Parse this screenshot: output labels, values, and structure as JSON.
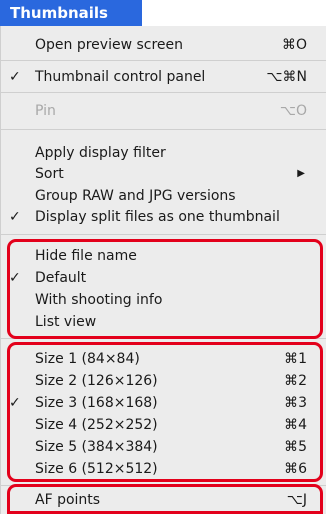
{
  "menu": {
    "title": "Thumbnails"
  },
  "items": [
    {
      "label": "Open preview screen",
      "shortcut": "⌘O"
    },
    {
      "check": "✓",
      "label": "Thumbnail control panel",
      "shortcut": "⌥⌘N"
    },
    {
      "label": "Pin",
      "shortcut": "⌥O"
    },
    {
      "label": "Apply display filter"
    },
    {
      "label": "Sort",
      "submenu_arrow": "▶"
    },
    {
      "label": "Group RAW and JPG versions"
    },
    {
      "check": "✓",
      "label": "Display split files as one thumbnail"
    },
    {
      "label": "Hide file name"
    },
    {
      "check": "✓",
      "label": "Default"
    },
    {
      "label": "With shooting info"
    },
    {
      "label": "List view"
    },
    {
      "label": "Size 1 (84×84)",
      "shortcut": "⌘1"
    },
    {
      "label": "Size 2 (126×126)",
      "shortcut": "⌘2"
    },
    {
      "check": "✓",
      "label": "Size 3 (168×168)",
      "shortcut": "⌘3"
    },
    {
      "label": "Size 4 (252×252)",
      "shortcut": "⌘4"
    },
    {
      "label": "Size 5 (384×384)",
      "shortcut": "⌘5"
    },
    {
      "label": "Size 6 (512×512)",
      "shortcut": "⌘6"
    },
    {
      "label": "AF points",
      "shortcut": "⌥J"
    }
  ],
  "colors": {
    "menubar_highlight": "#2a68de",
    "callout_border": "#e3001b",
    "disabled_text": "#a8a8a8"
  }
}
